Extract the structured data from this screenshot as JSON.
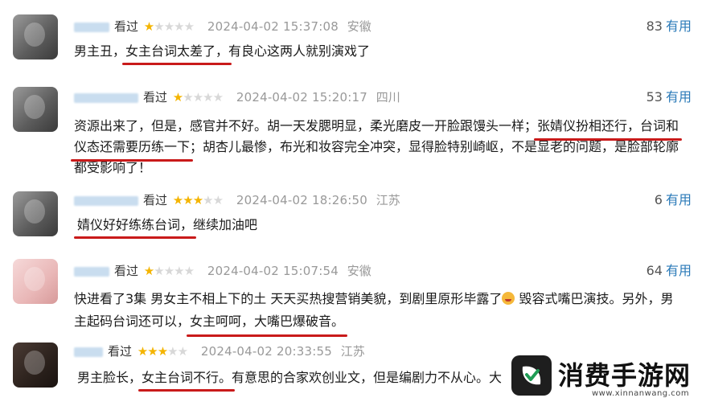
{
  "colors": {
    "star_on": "#f4b400",
    "star_off": "#d8d8d8",
    "useful_label": "#2a7ab8",
    "highlight_underline": "#c91a1a"
  },
  "reviews": [
    {
      "seen": "看过",
      "stars": 1,
      "time": "2024-04-02 15:37:08",
      "location": "安徽",
      "useful_count": "83",
      "useful_label": "有用",
      "content": [
        {
          "text": "男主丑，"
        },
        {
          "text": "女主台词太差了，",
          "hl": true
        },
        {
          "text": "有良心这两人就别演戏了"
        }
      ]
    },
    {
      "seen": "看过",
      "stars": 1,
      "time": "2024-04-02 15:20:17",
      "location": "四川",
      "useful_count": "53",
      "useful_label": "有用",
      "content_lines": [
        [
          {
            "text": "资源出来了，但是，感官并不好。胡一天发腮明显，柔光磨皮一开脸跟馒头一样；"
          },
          {
            "text": "张婧仪扮相还行，台词和",
            "hl": true
          }
        ],
        [
          {
            "text": "仪态还需要历练一下",
            "hl": true
          },
          {
            "text": "；胡杏儿最惨，布光和妆容完全冲突，显得脸特别崎岖，不是显老的问题，是脸部轮廓"
          }
        ],
        [
          {
            "text": "都受影响了！"
          }
        ]
      ]
    },
    {
      "seen": "看过",
      "stars": 3,
      "time": "2024-04-02 18:26:50",
      "location": "江苏",
      "useful_count": "6",
      "useful_label": "有用",
      "content": [
        {
          "text": "婧仪好好练练台词，",
          "hl": true
        },
        {
          "text": "继续加油吧"
        }
      ]
    },
    {
      "seen": "看过",
      "stars": 1,
      "time": "2024-04-02 15:07:54",
      "location": "安徽",
      "useful_count": "64",
      "useful_label": "有用",
      "content_lines": [
        [
          {
            "text": "快进看了3集 男女主不相上下的土 天天买热搜营销美貌，到剧里原形毕露了"
          },
          {
            "emoji": true
          },
          {
            "text": " 毁容式嘴巴演技。另外，男"
          }
        ],
        [
          {
            "text": "主起码台词还可以，"
          },
          {
            "text": "女主呵呵，大嘴巴爆破音。",
            "hl": true
          }
        ]
      ]
    },
    {
      "seen": "看过",
      "stars": 3,
      "time": "2024-04-02 20:33:55",
      "location": "江苏",
      "content": [
        {
          "text": "男主脸长，"
        },
        {
          "text": "女主台词不行。",
          "hl": true
        },
        {
          "text": "有意思的合家欢创业文，但是编剧力不从心。大"
        }
      ]
    }
  ],
  "watermark": {
    "title": "消费手游网",
    "url": "www.xinnanwang.com",
    "logo_icon": "leaf-check-icon"
  }
}
